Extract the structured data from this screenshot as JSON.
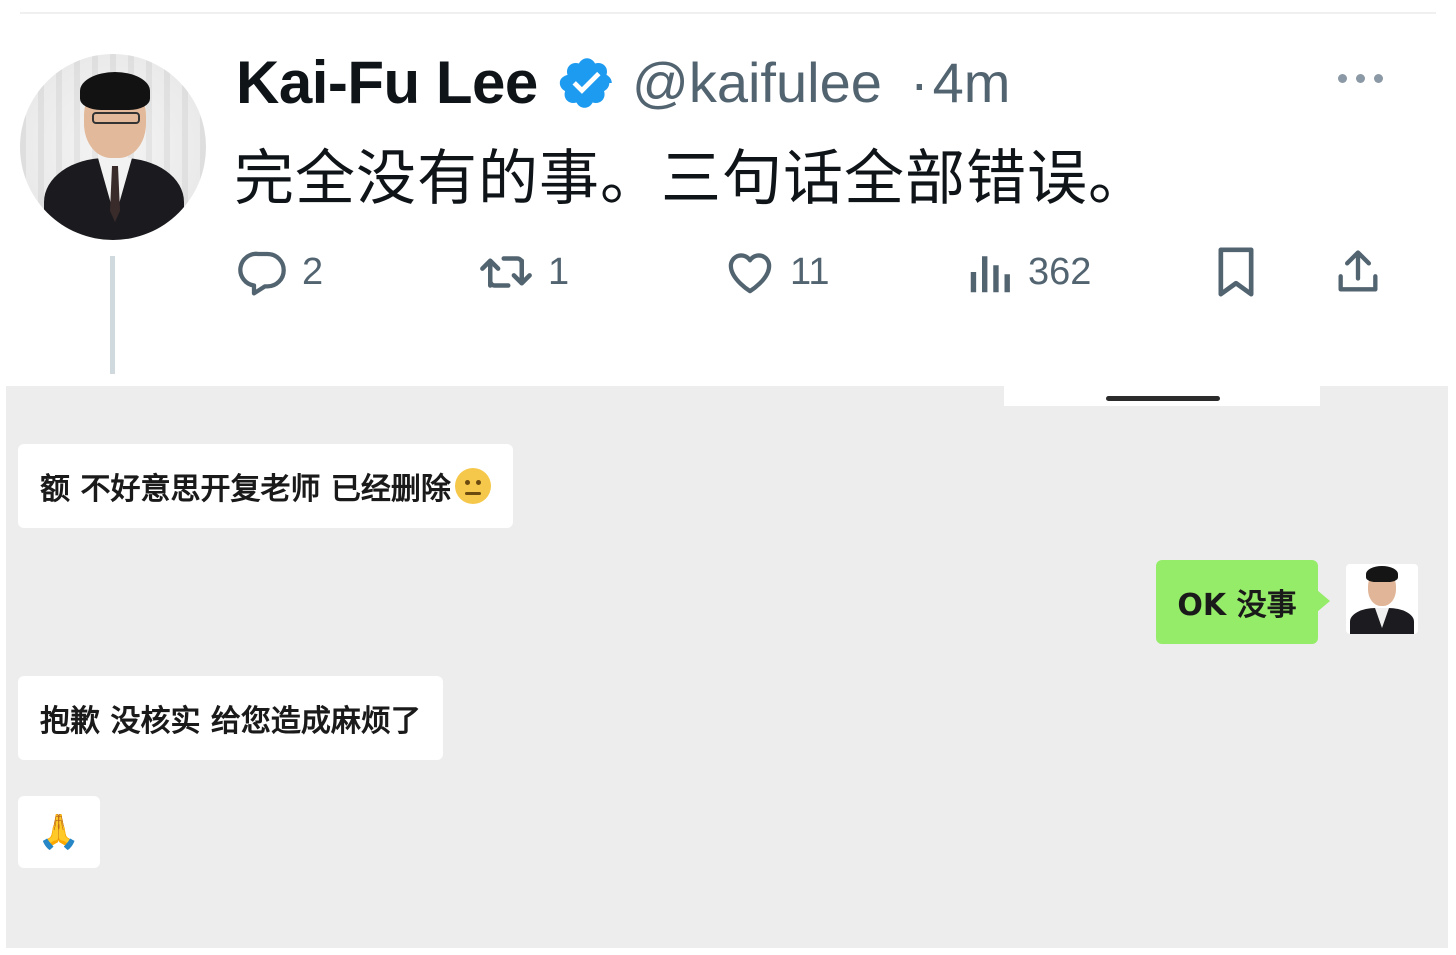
{
  "tweet": {
    "author_name": "Kai-Fu Lee",
    "verified_icon": "verified-badge-icon",
    "handle": "@kaifulee",
    "time": "4m",
    "text": "完全没有的事。三句话全部错误。",
    "actions": {
      "replies": "2",
      "retweets": "1",
      "likes": "11",
      "views": "362"
    },
    "colors": {
      "verified": "#1d9bf0",
      "muted": "#536471",
      "text": "#0f1419"
    }
  },
  "chat": {
    "background": "#ededed",
    "outgoing_bubble_color": "#95ec69",
    "messages": [
      {
        "side": "left",
        "text": "额 不好意思开复老师 已经删除",
        "emoji": "awkward-smile-emoji"
      },
      {
        "side": "right",
        "text": "OK 没事"
      },
      {
        "side": "left",
        "text": "抱歉 没核实 给您造成麻烦了"
      },
      {
        "side": "left",
        "text": "🙏"
      }
    ]
  }
}
